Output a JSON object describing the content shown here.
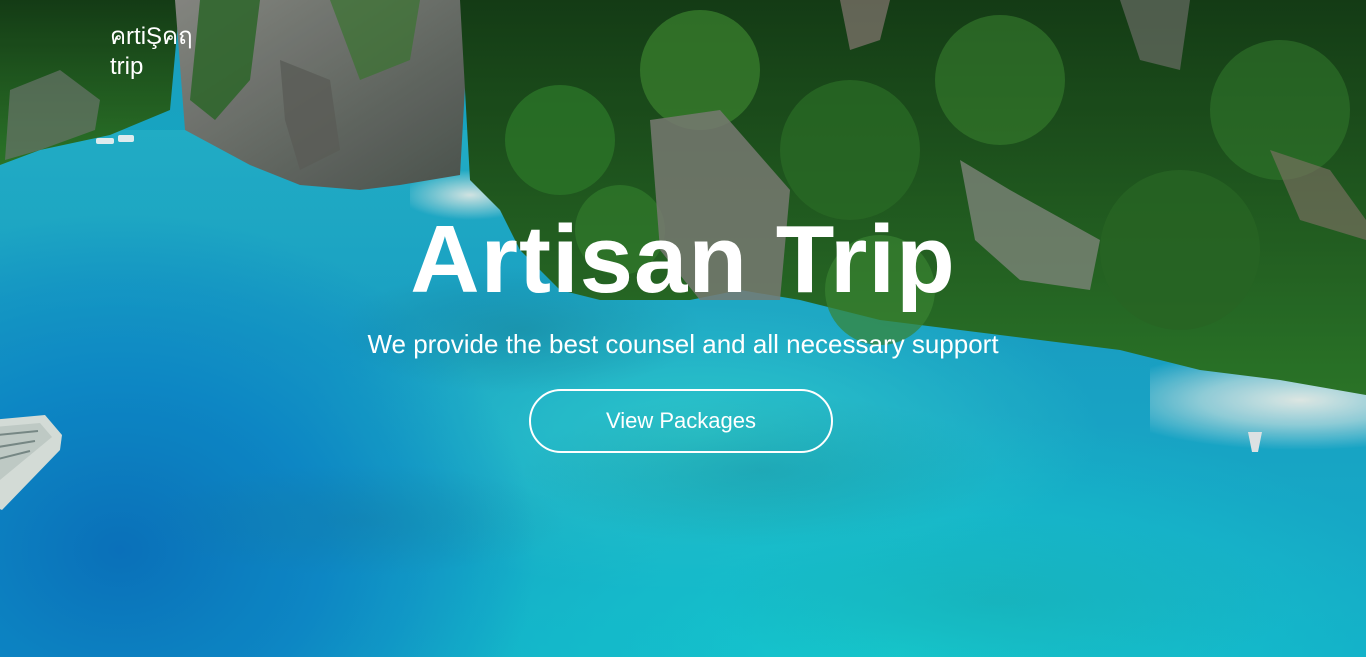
{
  "brand": {
    "logo_line1": "คrtiŞคฤ",
    "logo_line2": "trip"
  },
  "hero": {
    "title": "Artisan Trip",
    "tagline": "We provide the best counsel and all necessary support",
    "cta_label": "View Packages",
    "background": "aerial-tropical-island-photo"
  },
  "colors": {
    "text": "#ffffff",
    "sea": "#16b8d3",
    "forest": "#1f5f22"
  }
}
